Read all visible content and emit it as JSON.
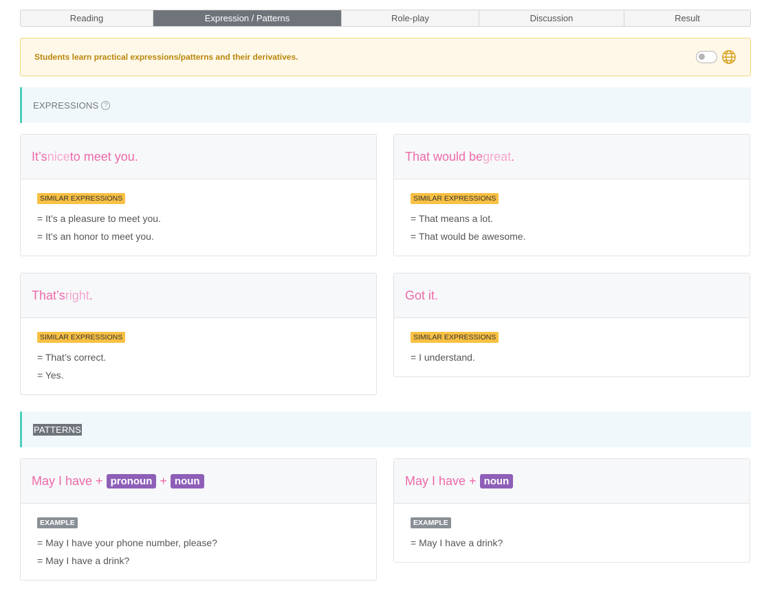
{
  "tabs": [
    "Reading",
    "Expression / Patterns",
    "Role-play",
    "Discussion",
    "Result"
  ],
  "notice": "Students learn practical expressions/patterns and their derivatives.",
  "expressions_header": "EXPRESSIONS",
  "patterns_header": "PATTERNS",
  "similar_label": "SIMILAR EXPRESSIONS",
  "example_label": "EXAMPLE",
  "cards": {
    "c1": {
      "a": "It’s ",
      "b": "nice",
      "c": " to meet you.",
      "l1": "= It’s a pleasure to meet you.",
      "l2": "= It’s an honor to meet you."
    },
    "c2": {
      "a": "That would be ",
      "b": "great",
      "c": ".",
      "l1": "= That means a lot.",
      "l2": "= That would be awesome."
    },
    "c3": {
      "a": "That’s ",
      "b": "right",
      "c": ".",
      "l1": "= That’s correct.",
      "l2": "= Yes."
    },
    "c4": {
      "a": "Got it.",
      "l1": "= I understand."
    }
  },
  "patterns": {
    "p1": {
      "a": "May I have +",
      "chip1": "pronoun",
      "plus": "+",
      "chip2": "noun",
      "l1": "= May I have your phone number, please?",
      "l2": "= May I have a drink?"
    },
    "p2": {
      "a": "May I have +",
      "chip1": "noun",
      "l1": "= May I have a drink?"
    }
  },
  "colors": {
    "accent_pink": "#ec6aa9",
    "chip_purple": "#8e5fb7",
    "badge_yellow": "#f9c043",
    "section_bar": "#4ccfb9"
  }
}
